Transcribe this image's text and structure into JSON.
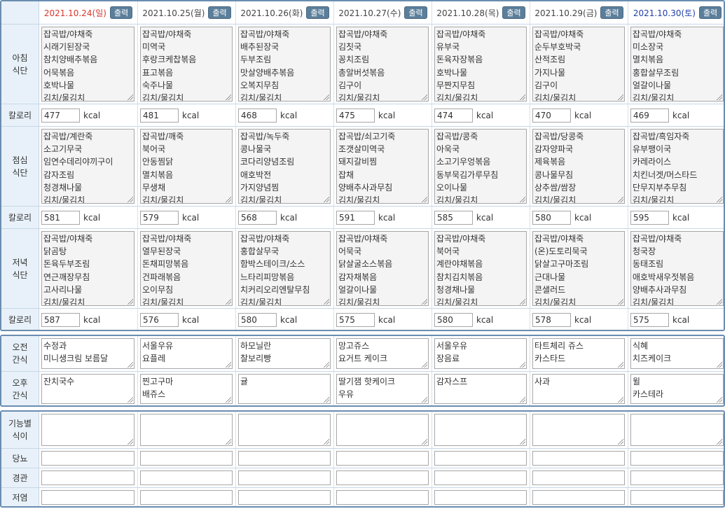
{
  "columns": [
    {
      "date": "2021.10.24(일)",
      "print": "출력",
      "kind": "sun"
    },
    {
      "date": "2021.10.25(월)",
      "print": "출력",
      "kind": "wk"
    },
    {
      "date": "2021.10.26(화)",
      "print": "출력",
      "kind": "wk"
    },
    {
      "date": "2021.10.27(수)",
      "print": "출력",
      "kind": "wk"
    },
    {
      "date": "2021.10.28(목)",
      "print": "출력",
      "kind": "wk"
    },
    {
      "date": "2021.10.29(금)",
      "print": "출력",
      "kind": "wk"
    },
    {
      "date": "2021.10.30(토)",
      "print": "출력",
      "kind": "sat"
    }
  ],
  "labels": {
    "breakfast": "아침\n식단",
    "lunch": "점심\n식단",
    "dinner": "저녁\n식단",
    "calorie": "칼로리",
    "am_snack": "오전\n간식",
    "pm_snack": "오후\n간식",
    "functional": "기능별\n식이",
    "diabetic": "당뇨",
    "tube": "경관",
    "low_salt": "저염",
    "kcal_unit": "kcal"
  },
  "breakfast": [
    "잡곡밥/야채죽\n시래기된장국\n참치양배추볶음\n어묵볶음\n호박나물\n김치/물김치",
    "잡곡밥/야채죽\n미역국\n후랑크케찹볶음\n표고볶음\n숙주나물\n김치/물김치",
    "잡곡밥/야채죽\n배추된장국\n두부조림\n맛살양배추볶음\n오복지무침\n김치/물김치",
    "잡곡밥/야채죽\n김칫국\n꽁치조림\n총알버섯볶음\n김구이\n김치/물김치",
    "잡곡밥/야채죽\n유부국\n돈육자장볶음\n호박나물\n무짠지무침\n김치/물김치",
    "잡곡밥/야채죽\n순두부호박국\n산적조림\n가지나물\n김구이\n김치/물김치",
    "잡곡밥/야채죽\n미소장국\n멸치볶음\n홍합살무조림\n얼갈이나물\n김치/물김치"
  ],
  "breakfast_kcal": [
    "477",
    "481",
    "468",
    "475",
    "474",
    "470",
    "469"
  ],
  "lunch": [
    "잡곡밥/계란죽\n소고기무국\n임연수데리야끼구이\n감자조림\n청경채나물\n김치/물김치",
    "잡곡밥/깨죽\n북어국\n안동찜닭\n멸치볶음\n무생채\n김치/물김치",
    "잡곡밥/녹두죽\n콩나물국\n코다리양념조림\n애호박전\n가지양념찜\n김치/물김치",
    "잡곡밥/쇠고기죽\n조갯살미역국\n돼지갈비찜\n잡채\n양배추사과무침\n김치/물김치",
    "잡곡밥/콩죽\n아욱국\n소고기우엉볶음\n동부묵김가루무침\n오이나물\n김치/물김치",
    "잡곡밥/당콩죽\n감자양파국\n제육볶음\n콩나물무침\n상추쌈/쌈장\n김치/물김치",
    "잡곡밥/흑임자죽\n유부팽이국\n카레라이스\n치킨너겟/머스타드\n단무지부추무침\n김치/물김치"
  ],
  "lunch_kcal": [
    "581",
    "579",
    "568",
    "591",
    "585",
    "580",
    "595"
  ],
  "dinner": [
    "잡곡밥/야채죽\n닭곰탕\n돈육두부조림\n연근깨장무침\n고사리나물\n김치/물김치",
    "잡곡밥/야채죽\n열무된장국\n돈채피망볶음\n건파래볶음\n오이무침\n김치/물김치",
    "잡곡밥/야채죽\n홍합살무국\n함박스테이크/소스\n느타리피망볶음\n치커리오리엔탈무침\n김치/물김치",
    "잡곡밥/야채죽\n어묵국\n닭살굴소스볶음\n감자채볶음\n얼갈이나물\n김치/물김치",
    "잡곡밥/야채죽\n북어국\n계란야채볶음\n참치김치볶음\n청경채나물\n김치/물김치",
    "잡곡밥/야채죽\n(온)도토리묵국\n닭살고구마조림\n근대나물\n콘샐러드\n김치/물김치",
    "잡곡밥/야채죽\n청국장\n동태조림\n애호박새우젓볶음\n양배추사과무침\n김치/물김치"
  ],
  "dinner_kcal": [
    "587",
    "576",
    "580",
    "575",
    "580",
    "578",
    "575"
  ],
  "am_snack": [
    "수정과\n미니생크림 보름달",
    "서울우유\n요플레",
    "하모닐란\n찰보리빵",
    "망고쥬스\n요거트 케이크",
    "서울우유\n장음료",
    "타트체리 쥬스\n카스타드",
    "식혜\n치즈케이크"
  ],
  "pm_snack": [
    "잔치국수",
    "찐고구마\n배쥬스",
    "귤",
    "딸기잼 핫케이크\n우유",
    "감자스프",
    "사과",
    "윌\n카스테라"
  ],
  "functional": [
    "",
    "",
    "",
    "",
    "",
    "",
    ""
  ],
  "diabetic": [
    "",
    "",
    "",
    "",
    "",
    "",
    ""
  ],
  "tube": [
    "",
    "",
    "",
    "",
    "",
    "",
    ""
  ],
  "low_salt": [
    "",
    "",
    "",
    "",
    "",
    "",
    ""
  ]
}
